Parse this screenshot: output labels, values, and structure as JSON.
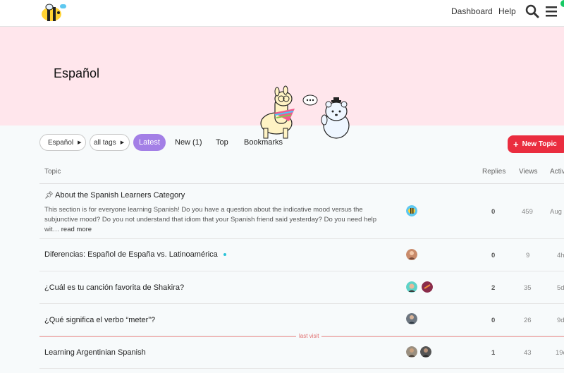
{
  "header": {
    "logo_badge": "",
    "nav": {
      "dashboard": "Dashboard",
      "help": "Help"
    },
    "icons": [
      "search-icon",
      "hamburger-menu-icon"
    ]
  },
  "banner": {
    "title": "Español"
  },
  "filters": {
    "category_label": "Español",
    "tags_label": "all tags",
    "tabs": [
      "Latest",
      "New (1)",
      "Top",
      "Bookmarks"
    ],
    "active_tab": "Latest",
    "new_topic_label": "New Topic"
  },
  "table": {
    "columns": {
      "topic": "Topic",
      "replies": "Replies",
      "views": "Views",
      "activity": "Activ"
    },
    "rows": [
      {
        "pinned": true,
        "title": "About the Spanish Learners Category",
        "excerpt": "This section is for everyone learning Spanish! Do you have a question about the indicative mood versus the subjunctive mood? Do you not understand that idiom that your Spanish friend said yesterday? Do you need help wit…",
        "read_more": "read more",
        "replies": "0",
        "views": "459",
        "activity": "Aug"
      },
      {
        "title": "Diferencias: Español de España vs. Latinoamérica",
        "unread": true,
        "replies": "0",
        "views": "9",
        "activity": "4h"
      },
      {
        "title": "¿Cuál es tu canción favorita de Shakira?",
        "replies": "2",
        "views": "35",
        "activity": "5d"
      },
      {
        "title": "¿Qué significa el verbo “meter”?",
        "replies": "0",
        "views": "26",
        "activity": "9d"
      },
      {
        "title": "Learning Argentinian Spanish",
        "replies": "1",
        "views": "43",
        "activity": "19d"
      }
    ],
    "last_visit_label": "last visit"
  },
  "colors": {
    "accent_purple": "#a37fe6",
    "new_topic_red": "#ea2d3f",
    "banner_pink": "#ffe6ec",
    "unread_dot": "#2bc3d8"
  }
}
